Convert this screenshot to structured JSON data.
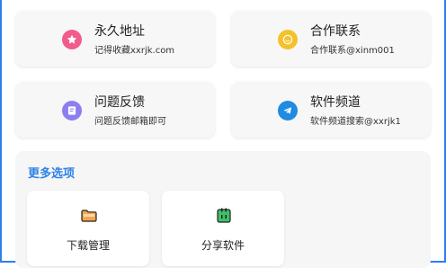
{
  "cards": [
    {
      "title": "永久地址",
      "subtitle": "记得收藏xxrjk.com",
      "icon": "star-icon",
      "color": "#f25c8c"
    },
    {
      "title": "合作联系",
      "subtitle": "合作联系@xinm001",
      "icon": "smile-icon",
      "color": "#f3c22b"
    },
    {
      "title": "问题反馈",
      "subtitle": "问题反馈邮箱即可",
      "icon": "feedback-icon",
      "color": "#8d7ef0"
    },
    {
      "title": "软件频道",
      "subtitle": "软件频道搜索@xxrjk1",
      "icon": "telegram-icon",
      "color": "#1f8be1"
    }
  ],
  "more": {
    "title": "更多选项",
    "items": [
      {
        "label": "下载管理",
        "icon": "folder-icon",
        "color": "#f4a64a"
      },
      {
        "label": "分享软件",
        "icon": "share-icon",
        "color": "#3fbf6a"
      }
    ]
  }
}
